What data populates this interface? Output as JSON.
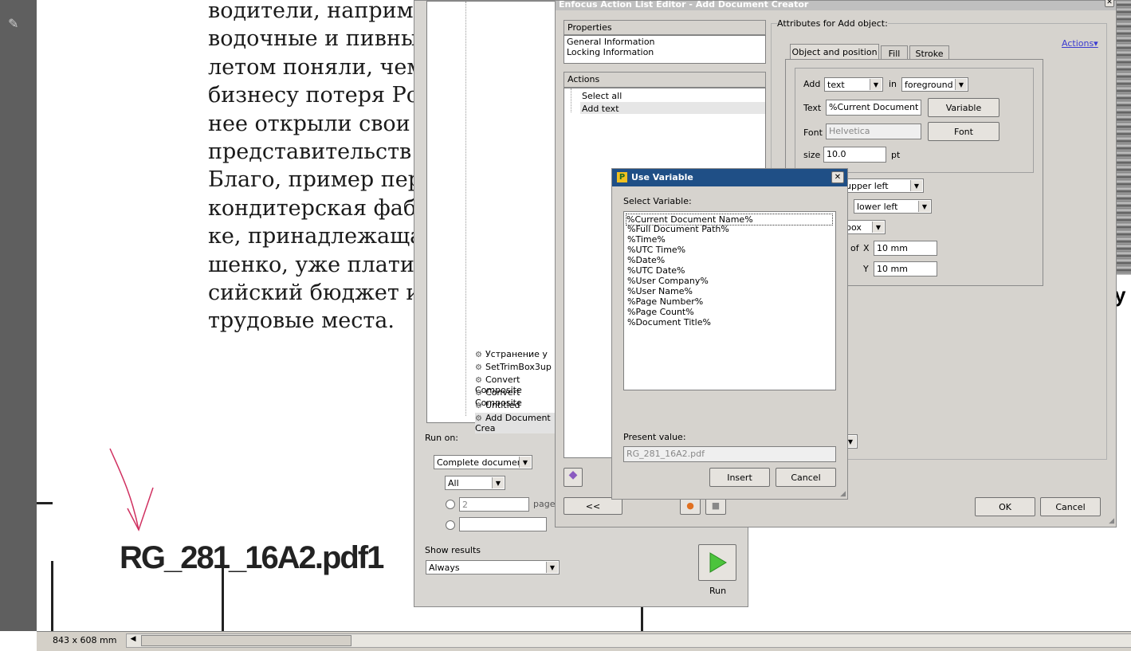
{
  "document": {
    "russian_lines": [
      "водители, наприм",
      "водочные и пивны",
      "летом поняли, чем",
      "бизнесу потеря Ро",
      "нее открыли свои",
      "представительств",
      "Благо, пример пер",
      "кондитерская фаб",
      "ке, принадлежаща",
      "шенко, уже платит",
      "сийский бюджет и",
      "трудовые места."
    ],
    "big_filename": "RG_281_16A2.pdf1",
    "right_char": "у"
  },
  "statusbar": {
    "dimensions": "843 x 608 mm"
  },
  "sequence_panel": {
    "tree_items": [
      "Устранение у",
      "SetTrimBox3up",
      "Convert Composite",
      "Convert Composite",
      "Untitled",
      "Add Document Crea"
    ],
    "run_on_label": "Run on:",
    "run_on_value": "Complete document",
    "pages_value": "All",
    "page_spin_value": "2",
    "page_label": "page",
    "show_results_label": "Show results",
    "show_results_value": "Always",
    "run_label": "Run"
  },
  "editor": {
    "title": "Enfocus Action List Editor - Add Document Creator",
    "properties_header": "Properties",
    "properties_items": [
      "General Information",
      "Locking Information"
    ],
    "actions_header": "Actions",
    "actions_items": [
      "Select all",
      "Add text"
    ],
    "back_label": "<<",
    "attributes_label": "Attributes for Add object:",
    "actions_link": "Actions▾",
    "tabs": [
      "Object and position",
      "Fill",
      "Stroke"
    ],
    "add_label": "Add",
    "add_value": "text",
    "in_label": "in",
    "in_value": "foreground",
    "text_label": "Text",
    "text_value": "%Current Document Na",
    "variable_button": "Variable",
    "font_label": "Font",
    "font_value": "Helvetica",
    "font_button": "Font",
    "size_label": "size",
    "size_value": "10.0",
    "size_unit": "pt",
    "anchor1": "upper left",
    "anchor2": "lower left",
    "box_value": "box",
    "of_label": "of",
    "x_label": "X",
    "x_value": "10 mm",
    "y_label": "Y",
    "y_value": "10 mm",
    "ok_button": "OK",
    "cancel_button": "Cancel"
  },
  "use_variable": {
    "title": "Use Variable",
    "select_label": "Select Variable:",
    "variables": [
      "%Current Document Name%",
      "%Full Document Path%",
      "%Time%",
      "%UTC Time%",
      "%Date%",
      "%UTC Date%",
      "%User Company%",
      "%User Name%",
      "%Page Number%",
      "%Page Count%",
      "%Document Title%"
    ],
    "present_label": "Present value:",
    "present_value": "RG_281_16A2.pdf",
    "insert_button": "Insert",
    "cancel_button": "Cancel"
  },
  "colors": {
    "accent_link": "#3a3ad0",
    "arrow": "#d03060"
  }
}
